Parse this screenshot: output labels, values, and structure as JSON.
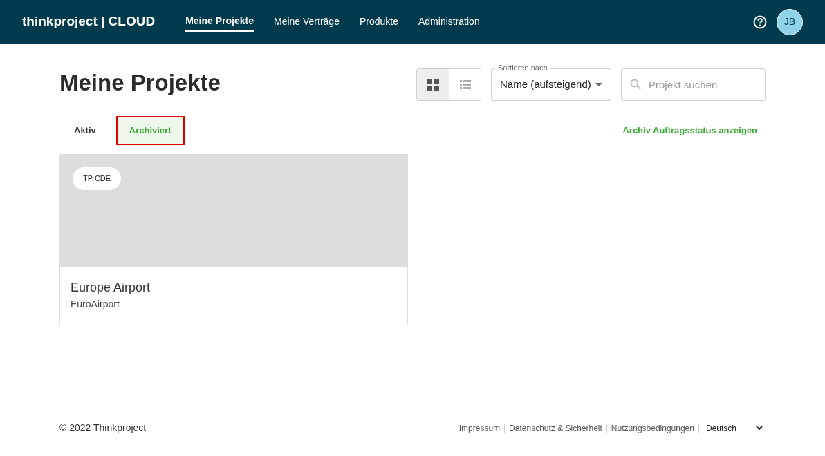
{
  "header": {
    "logo": "thinkproject | CLOUD",
    "nav": [
      {
        "label": "Meine Projekte",
        "selected": true
      },
      {
        "label": "Meine Verträge",
        "selected": false
      },
      {
        "label": "Produkte",
        "selected": false
      },
      {
        "label": "Administration",
        "selected": false
      }
    ],
    "avatar": "JB"
  },
  "page_title": "Meine Projekte",
  "view_toggle": [
    {
      "kind": "grid",
      "selected": true
    },
    {
      "kind": "list",
      "selected": false
    }
  ],
  "sort": {
    "label": "Sortieren nach",
    "value": "Name (aufsteigend)"
  },
  "search": {
    "placeholder": "Projekt suchen"
  },
  "tabs": [
    {
      "label": "Aktiv",
      "selected": false
    },
    {
      "label": "Archiviert",
      "selected": true
    }
  ],
  "archive_link": "Archiv Auftragsstatus anzeigen",
  "projects": [
    {
      "badge": "TP CDE",
      "name": "Europe Airport",
      "subtitle": "EuroAirport"
    }
  ],
  "footer": {
    "copyright": "© 2022 Thinkproject",
    "links": [
      "Impressum",
      "Datenschutz & Sicherheit",
      "Nutzungsbedingungen"
    ],
    "language": "Deutsch"
  }
}
